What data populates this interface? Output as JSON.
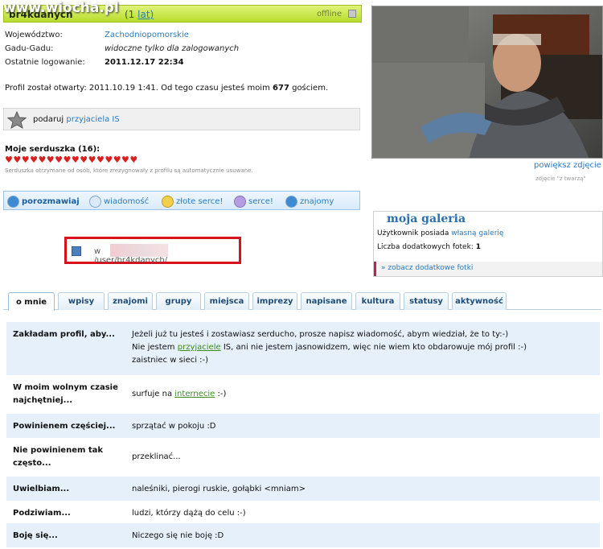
{
  "watermark": "www.wiocha.pl",
  "profile": {
    "name": "br4kdanych",
    "age_prefix": "(1",
    "age_link": "lat)",
    "status": "offline",
    "info": [
      {
        "label": "Województwo:",
        "value": "Zachodniopomorskie"
      },
      {
        "label": "Gadu-Gadu:",
        "value": "widoczne tylko dla zalogowanych"
      },
      {
        "label": "Ostatnie logowanie:",
        "value": "2011.12.17 22:34"
      }
    ],
    "opened_prefix": "Profil został otwarty: 2011.10.19 1:41. Od tego czasu jesteś moim",
    "opened_count": "677",
    "opened_suffix": "gościem."
  },
  "gift": {
    "text": "podaruj",
    "link": "przyjaciela IS"
  },
  "hearts": {
    "title": "Moje serduszka (16):",
    "count": 16,
    "glyph": "♥",
    "note": "Serduszka otrzymane od osób, które zrezygnowały z profilu są automatycznie usuwane."
  },
  "actions": {
    "chat": "porozmawiaj",
    "message": "wiadomość",
    "gold_heart": "złote serce!",
    "heart": "serce!",
    "friends": "znajomy"
  },
  "url": {
    "prefix": "w",
    "path": "/user/br4kdanych/"
  },
  "photo": {
    "enlarge": "powiększ zdjęcie",
    "note": "zdjęcie \"z twarzą\""
  },
  "gallery": {
    "title": "moja galeria",
    "line1_prefix": "Użytkownik posiada",
    "line1_link": "własną galerię",
    "line2_prefix": "Liczba dodatkowych fotek:",
    "line2_count": "1",
    "more": "» zobacz dodatkowe fotki"
  },
  "tabs": [
    "o mnie",
    "wpisy",
    "znajomi",
    "grupy",
    "miejsca",
    "imprezy",
    "napisane",
    "kultura",
    "statusy",
    "aktywność"
  ],
  "about": [
    {
      "label": "Zakładam profil, aby...",
      "lines": [
        "Jeżeli już tu jesteś i zostawiasz serducho, prosze napisz wiadomość, abym wiedział, że to ty:-)",
        "Nie jestem |przyjaciele| IS, ani nie jestem jasnowidzem, więc nie wiem kto obdarowuje mój profil :-)",
        "zaistniec w sieci :-)"
      ]
    },
    {
      "label": "W moim wolnym czasie najchętniej...",
      "lines": [
        "surfuje na |internecie| :-)"
      ]
    },
    {
      "label": "Powinienem częściej...",
      "lines": [
        "sprzątać w pokoju :D"
      ]
    },
    {
      "label": "Nie powinienem tak często...",
      "lines": [
        "przeklinać..."
      ]
    },
    {
      "label": "Uwielbiam...",
      "lines": [
        "naleśniki, pierogi ruskie, gołąbki <mniam>"
      ]
    },
    {
      "label": "Podziwiam...",
      "lines": [
        "ludzi, którzy dążą do celu :-)"
      ]
    },
    {
      "label": "Boję się...",
      "lines": [
        "Niczego się nie boję :D"
      ]
    }
  ]
}
